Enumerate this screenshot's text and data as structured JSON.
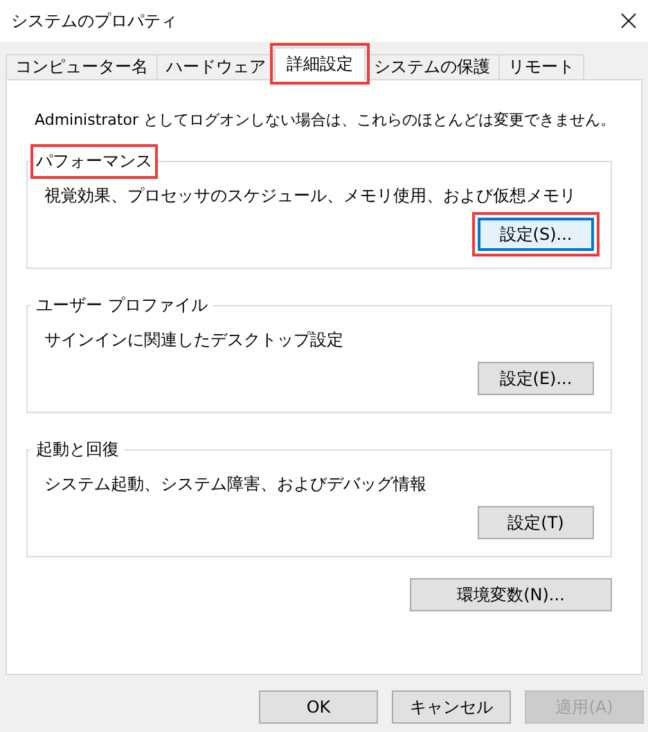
{
  "window": {
    "title": "システムのプロパティ"
  },
  "tabs": [
    {
      "label": "コンピューター名",
      "selected": false,
      "highlighted": false
    },
    {
      "label": "ハードウェア",
      "selected": false,
      "highlighted": false
    },
    {
      "label": "詳細設定",
      "selected": true,
      "highlighted": true
    },
    {
      "label": "システムの保護",
      "selected": false,
      "highlighted": false
    },
    {
      "label": "リモート",
      "selected": false,
      "highlighted": false
    }
  ],
  "notice": "Administrator としてログオンしない場合は、これらのほとんどは変更できません。",
  "groups": [
    {
      "title": "パフォーマンス",
      "highlighted": true,
      "description": "視覚効果、プロセッサのスケジュール、メモリ使用、および仮想メモリ",
      "button": {
        "label": "設定(S)...",
        "focused": true,
        "highlighted": true
      }
    },
    {
      "title": "ユーザー プロファイル",
      "highlighted": false,
      "description": "サインインに関連したデスクトップ設定",
      "button": {
        "label": "設定(E)...",
        "focused": false,
        "highlighted": false
      }
    },
    {
      "title": "起動と回復",
      "highlighted": false,
      "description": "システム起動、システム障害、およびデバッグ情報",
      "button": {
        "label": "設定(T)",
        "focused": false,
        "highlighted": false
      }
    }
  ],
  "environment_button": {
    "label": "環境変数(N)..."
  },
  "footer_buttons": [
    {
      "label": "OK",
      "disabled": false
    },
    {
      "label": "キャンセル",
      "disabled": false
    },
    {
      "label": "適用(A)",
      "disabled": true
    }
  ]
}
